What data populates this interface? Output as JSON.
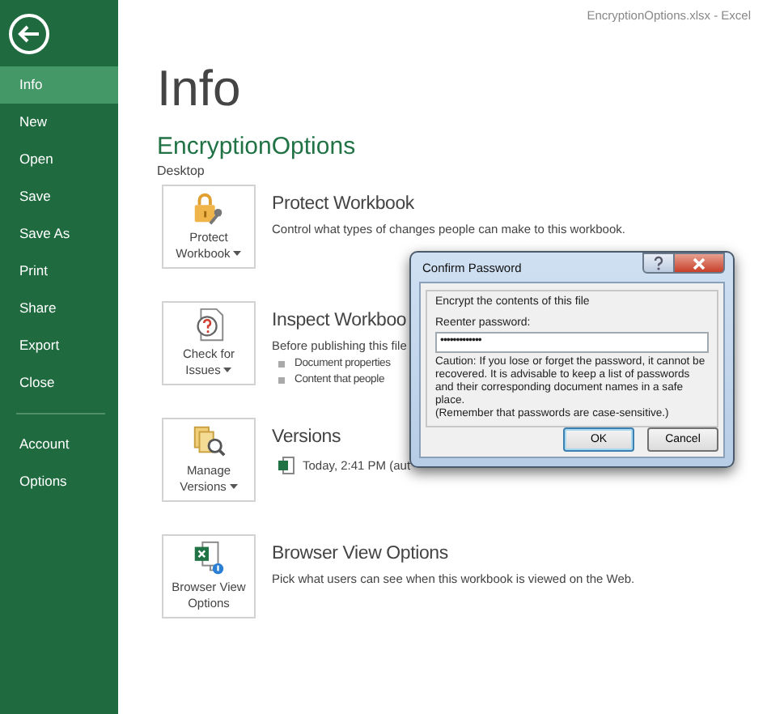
{
  "window": {
    "title": "EncryptionOptions.xlsx - Excel"
  },
  "sidebar": {
    "items": [
      {
        "label": "Info",
        "selected": true
      },
      {
        "label": "New",
        "selected": false
      },
      {
        "label": "Open",
        "selected": false
      },
      {
        "label": "Save",
        "selected": false
      },
      {
        "label": "Save As",
        "selected": false
      },
      {
        "label": "Print",
        "selected": false
      },
      {
        "label": "Share",
        "selected": false
      },
      {
        "label": "Export",
        "selected": false
      },
      {
        "label": "Close",
        "selected": false
      }
    ],
    "lower_items": [
      {
        "label": "Account",
        "selected": false
      },
      {
        "label": "Options",
        "selected": false
      }
    ]
  },
  "page": {
    "title": "Info",
    "file_name": "EncryptionOptions",
    "location": "Desktop"
  },
  "sections": [
    {
      "kind": "protect",
      "button_lines": [
        "Protect",
        "Workbook"
      ],
      "has_menu": true,
      "heading": "Protect Workbook",
      "description": "Control what types of changes people can make to this workbook."
    },
    {
      "kind": "inspect",
      "button_lines": [
        "Check for",
        "Issues"
      ],
      "has_menu": true,
      "heading": "Inspect Workboo",
      "description": "Before publishing this file",
      "bullets": [
        "Document properties",
        "Content that people"
      ]
    },
    {
      "kind": "versions",
      "button_lines": [
        "Manage",
        "Versions"
      ],
      "has_menu": true,
      "heading": "Versions",
      "version_entry": "Today, 2:41 PM (aut"
    },
    {
      "kind": "browser",
      "button_lines": [
        "Browser View",
        "Options"
      ],
      "has_menu": false,
      "heading": "Browser View Options",
      "description": "Pick what users can see when this workbook is viewed on the Web."
    }
  ],
  "dialog": {
    "title": "Confirm Password",
    "group_label": "Encrypt the contents of this file",
    "field_label": "Reenter password:",
    "password": "•••••••••••••",
    "caution": "Caution: If you lose or forget the password, it cannot be recovered. It is advisable to keep a list of passwords and their corresponding document names in a safe place.",
    "reminder": "(Remember that passwords are case-sensitive.)",
    "buttons": [
      {
        "label": "OK",
        "default": true
      },
      {
        "label": "Cancel",
        "default": false
      }
    ]
  }
}
